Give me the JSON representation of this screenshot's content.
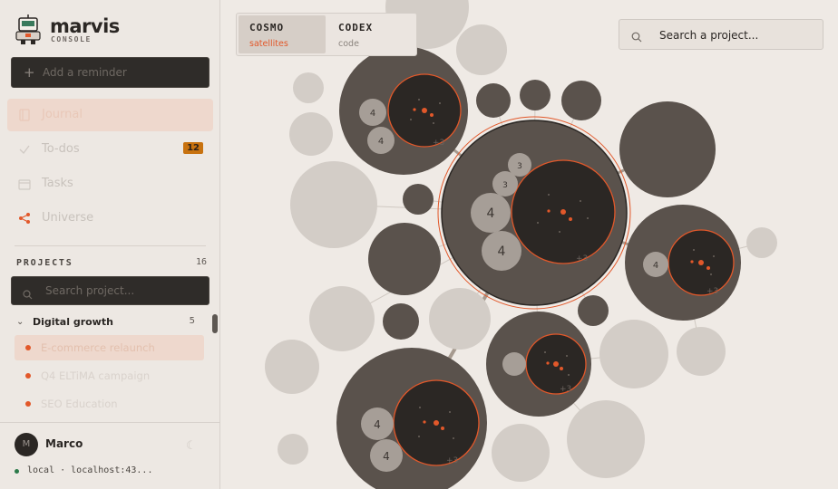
{
  "brand": {
    "name": "marvis",
    "subtitle": "CONSOLE"
  },
  "reminder": {
    "icon": "plus-icon",
    "placeholder": "Add a reminder"
  },
  "nav": [
    {
      "label": "Journal",
      "icon": "journal-icon",
      "active": true
    },
    {
      "label": "To-dos",
      "icon": "check-icon",
      "badge": "12"
    },
    {
      "label": "Tasks",
      "icon": "calendar-icon"
    },
    {
      "label": "Universe",
      "icon": "share-icon"
    }
  ],
  "projects": {
    "heading": "PROJECTS",
    "count": "16",
    "search_placeholder": "Search project...",
    "group": {
      "name": "Digital growth",
      "count": "5"
    },
    "items": [
      {
        "label": "E-commerce relaunch",
        "active": true
      },
      {
        "label": "Q4 ELTiMA campaign"
      },
      {
        "label": "SEO Education"
      }
    ]
  },
  "user": {
    "initial": "M",
    "name": "Marco",
    "connection": "local · localhost:43..."
  },
  "switcher": [
    {
      "title": "COSMO",
      "subtitle": "satellites",
      "active": true
    },
    {
      "title": "CODEX",
      "subtitle": "code"
    }
  ],
  "canvas_search": {
    "placeholder": "Search a project..."
  },
  "bubbles": {
    "sat_labels": [
      "4",
      "4",
      "3",
      "3",
      "4",
      "4",
      "4",
      "4",
      "4"
    ],
    "more_labels": [
      "+3",
      "+3",
      "+3",
      "+3",
      "+3"
    ]
  },
  "colors": {
    "accent": "#e2582a",
    "dark": "#2b2724",
    "bubble_mid": "#5a524c",
    "bubble_light": "#d3cdc7",
    "badge": "#c8720f"
  }
}
